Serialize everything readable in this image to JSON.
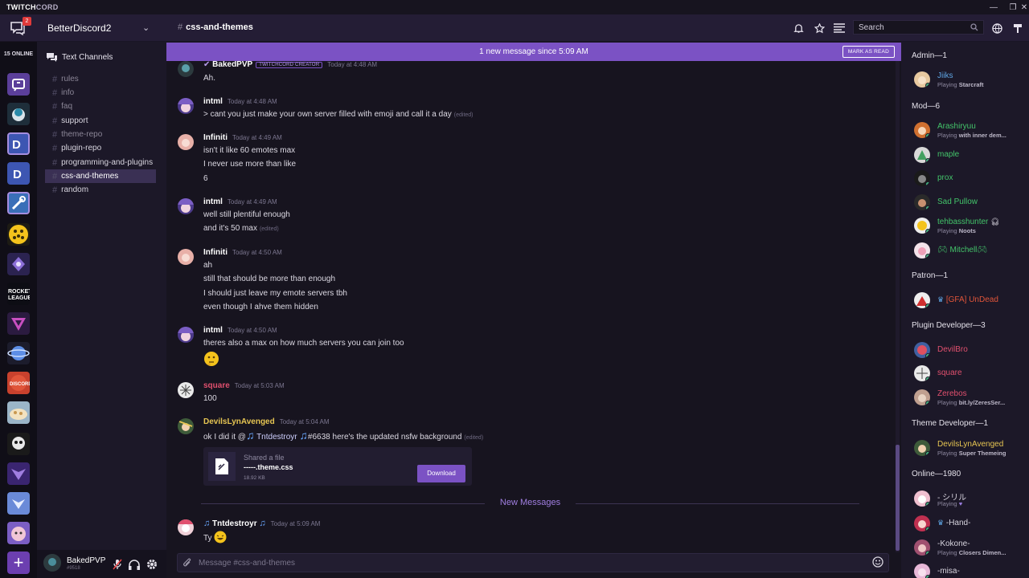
{
  "titlebar": {
    "brand_a": "TWITCH",
    "brand_b": "CORD"
  },
  "header": {
    "inbox_badge": "2",
    "server_name": "BetterDiscord2",
    "channel_name": "css-and-themes",
    "search_placeholder": "Search"
  },
  "guilds": {
    "online_count": "15 ONLINE"
  },
  "channels": {
    "category": "Text Channels",
    "items": [
      {
        "name": "rules",
        "state": "muted"
      },
      {
        "name": "info",
        "state": "muted"
      },
      {
        "name": "faq",
        "state": "muted"
      },
      {
        "name": "support",
        "state": "bright"
      },
      {
        "name": "theme-repo",
        "state": "muted"
      },
      {
        "name": "plugin-repo",
        "state": "bright"
      },
      {
        "name": "programming-and-plugins",
        "state": "bright"
      },
      {
        "name": "css-and-themes",
        "state": "active"
      },
      {
        "name": "random",
        "state": "bright"
      }
    ]
  },
  "user": {
    "name": "BakedPVP",
    "tag": "#9518"
  },
  "newbar": {
    "text": "1 new message since 5:09 AM",
    "button": "MARK AS READ"
  },
  "messages": [
    {
      "author": "BakedPVP",
      "color": "#ffffff",
      "badge": "TWITCHCORD CREATOR",
      "time": "Today at 4:48 AM",
      "lines": [
        "Ah."
      ]
    },
    {
      "author": "intml",
      "color": "#ffffff",
      "time": "Today at 4:48 AM",
      "lines": [
        "> cant you just make your own server filled with emoji and call it a day"
      ],
      "edited": "(edited)"
    },
    {
      "author": "Infiniti",
      "color": "#ffffff",
      "time": "Today at 4:49 AM",
      "lines": [
        "isn't it like 60 emotes max",
        "I never use more than like",
        "6"
      ]
    },
    {
      "author": "intml",
      "color": "#ffffff",
      "time": "Today at 4:49 AM",
      "lines": [
        "well still plentiful enough",
        "and it's 50 max"
      ],
      "edited": "(edited)"
    },
    {
      "author": "Infiniti",
      "color": "#ffffff",
      "time": "Today at 4:50 AM",
      "lines": [
        "ah",
        "still that should be more than enough",
        "I should just leave my emote servers tbh",
        "even though I ahve them hidden"
      ]
    },
    {
      "author": "intml",
      "color": "#ffffff",
      "time": "Today at 4:50 AM",
      "lines": [
        "theres also a max on how much servers you can join too"
      ]
    },
    {
      "author": "square",
      "color": "#e0506e",
      "time": "Today at 5:03 AM",
      "lines": [
        "100"
      ]
    },
    {
      "author": "DevilsLynAvenged",
      "color": "#e6c552",
      "time": "Today at 5:04 AM",
      "line_a": "ok I did it @",
      "mention": "Tntdestroyr",
      "line_b": "#6638 here's the updated nsfw background",
      "edited": "(edited)"
    },
    {
      "author": "Tntdestroyr",
      "color": "#ffffff",
      "time": "Today at 5:09 AM",
      "lines": [
        "Ty"
      ]
    }
  ],
  "attachment": {
    "label": "Shared a file",
    "filename": "-----.theme.css",
    "size": "18.92 KB",
    "button": "Download"
  },
  "divider": "New Messages",
  "composer": {
    "placeholder": "Message #css-and-themes"
  },
  "members": {
    "groups": [
      {
        "label": "Admin—1"
      },
      {
        "label": "Mod—6"
      },
      {
        "label": "Patron—1"
      },
      {
        "label": "Plugin Developer—3"
      },
      {
        "label": "Theme Developer—1"
      },
      {
        "label": "Online—1980"
      }
    ],
    "list": [
      {
        "name": "Jiiks",
        "color": "#5fa7e6",
        "game_prefix": "Playing",
        "game": "Starcraft"
      },
      {
        "name": "Arashiryuu",
        "color": "#43c46a",
        "game_prefix": "Playing",
        "game": "with inner dem..."
      },
      {
        "name": "maple",
        "color": "#43c46a"
      },
      {
        "name": "prox",
        "color": "#43c46a"
      },
      {
        "name": "Sad Pullow",
        "color": "#43c46a"
      },
      {
        "name": "tehbasshunter",
        "color": "#43c46a",
        "game_prefix": "Playing",
        "game": "Noots"
      },
      {
        "name": "Mitchell",
        "color": "#43c46a"
      },
      {
        "name": "[GFA] UnDead",
        "color": "#e0553a"
      },
      {
        "name": "DevilBro",
        "color": "#e0506e"
      },
      {
        "name": "square",
        "color": "#e0506e"
      },
      {
        "name": "Zerebos",
        "color": "#e0506e",
        "game_prefix": "Playing",
        "game": "bit.ly/ZeresSer..."
      },
      {
        "name": "DevilsLynAvenged",
        "color": "#e6c552",
        "game_prefix": "Playing",
        "game": "Super Themeing"
      },
      {
        "name": "- シリル",
        "color": "#d8d5df",
        "game_prefix": "Playing",
        "game": "♥"
      },
      {
        "name": "-Hand-",
        "color": "#d8d5df"
      },
      {
        "name": "-Kokone-",
        "color": "#d8d5df",
        "game_prefix": "Playing",
        "game": "Closers Dimen..."
      },
      {
        "name": "-misa-",
        "color": "#d8d5df"
      }
    ]
  },
  "colors": {
    "accent": "#7b52c4",
    "online": "#43b581",
    "idle": "#faa61a",
    "dnd": "#f04747"
  }
}
